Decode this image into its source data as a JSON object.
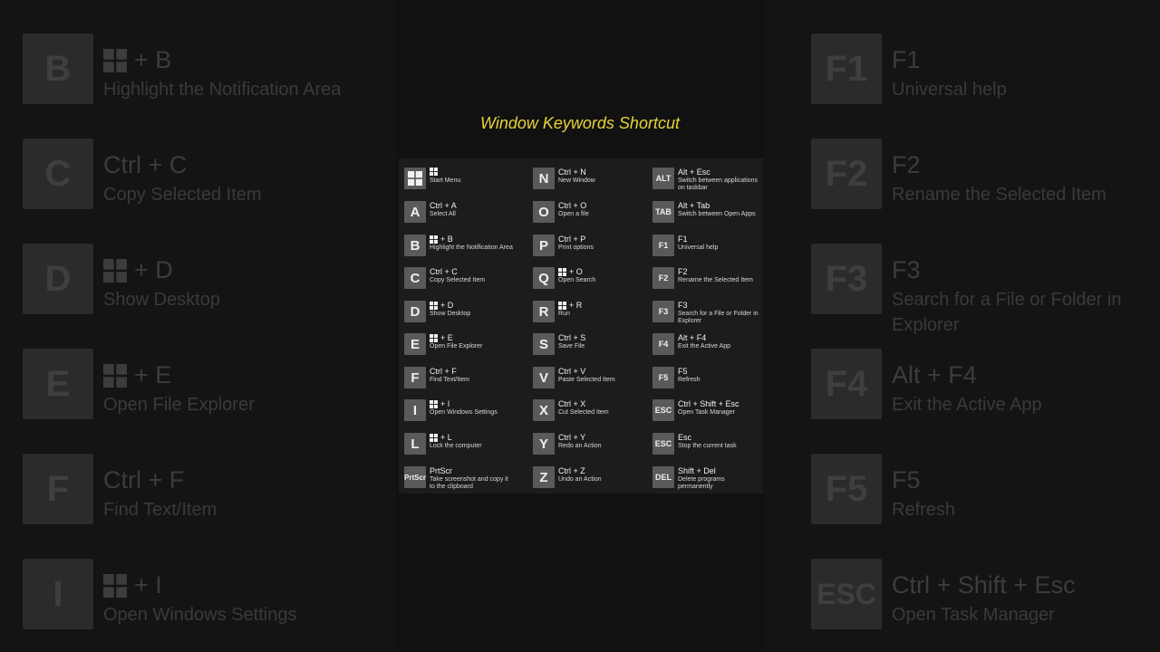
{
  "title": "Window Keywords Shortcut",
  "left_panel": [
    {
      "key": "B",
      "win": true,
      "combo": "+ B",
      "desc": "Highlight the Notification Area"
    },
    {
      "key": "C",
      "win": false,
      "combo": "Ctrl + C",
      "desc": "Copy Selected Item"
    },
    {
      "key": "D",
      "win": true,
      "combo": "+ D",
      "desc": "Show Desktop"
    },
    {
      "key": "E",
      "win": true,
      "combo": "+ E",
      "desc": "Open File Explorer"
    },
    {
      "key": "F",
      "win": false,
      "combo": "Ctrl + F",
      "desc": "Find Text/Item"
    },
    {
      "key": "I",
      "win": true,
      "combo": "+ I",
      "desc": "Open Windows Settings"
    }
  ],
  "right_panel": [
    {
      "key": "F1",
      "combo": "F1",
      "desc": "Universal help"
    },
    {
      "key": "F2",
      "combo": "F2",
      "desc": "Rename the Selected Item"
    },
    {
      "key": "F3",
      "combo": "F3",
      "desc": "Search for a File or Folder in Explorer"
    },
    {
      "key": "F4",
      "combo": "Alt  + F4",
      "desc": "Exit the Active App"
    },
    {
      "key": "F5",
      "combo": "F5",
      "desc": "Refresh"
    },
    {
      "key": "ESC",
      "combo": "Ctrl + Shift + Esc",
      "desc": "Open Task Manager"
    }
  ],
  "columns": [
    [
      {
        "key": "",
        "win_key": true,
        "win": true,
        "combo": "",
        "desc": "Start Menu"
      },
      {
        "key": "A",
        "win": false,
        "combo": "Ctrl + A",
        "desc": "Select All"
      },
      {
        "key": "B",
        "win": true,
        "combo": "+ B",
        "desc": "Highlight the Notification Area"
      },
      {
        "key": "C",
        "win": false,
        "combo": "Ctrl + C",
        "desc": "Copy Selected Item"
      },
      {
        "key": "D",
        "win": true,
        "combo": "+ D",
        "desc": "Show Desktop"
      },
      {
        "key": "E",
        "win": true,
        "combo": "+ E",
        "desc": "Open File Explorer"
      },
      {
        "key": "F",
        "win": false,
        "combo": "Ctrl + F",
        "desc": "Find Text/Item"
      },
      {
        "key": "I",
        "win": true,
        "combo": "+ I",
        "desc": "Open Windows Settings"
      },
      {
        "key": "L",
        "win": true,
        "combo": "+ L",
        "desc": "Lock the computer"
      },
      {
        "key": "PrtScr",
        "win": false,
        "combo": "PrtScr",
        "desc": "Take screenshot and copy it to the clipboard"
      }
    ],
    [
      {
        "key": "N",
        "win": false,
        "combo": "Ctrl + N",
        "desc": "New Window"
      },
      {
        "key": "O",
        "win": false,
        "combo": "Ctrl + O",
        "desc": "Open a file"
      },
      {
        "key": "P",
        "win": false,
        "combo": "Ctrl  + P",
        "desc": "Print options"
      },
      {
        "key": "Q",
        "win": true,
        "combo": "+ O",
        "desc": "Open Search"
      },
      {
        "key": "R",
        "win": true,
        "combo": "+ R",
        "desc": "Run"
      },
      {
        "key": "S",
        "win": false,
        "combo": "Ctrl + S",
        "desc": "Save File"
      },
      {
        "key": "V",
        "win": false,
        "combo": "Ctrl + V",
        "desc": "Paste Selected Item"
      },
      {
        "key": "X",
        "win": false,
        "combo": "Ctrl + X",
        "desc": "Cut Selected Item"
      },
      {
        "key": "Y",
        "win": false,
        "combo": "Ctrl + Y",
        "desc": "Redo an Action"
      },
      {
        "key": "Z",
        "win": false,
        "combo": "Ctrl + Z",
        "desc": "Undo an Action"
      }
    ],
    [
      {
        "key": "ALT",
        "win": false,
        "combo": "Alt + Esc",
        "desc": "Switch between applications on taskbar"
      },
      {
        "key": "TAB",
        "win": false,
        "combo": "Alt + Tab",
        "desc": "Switch between Open Apps"
      },
      {
        "key": "F1",
        "win": false,
        "combo": "F1",
        "desc": "Universal help"
      },
      {
        "key": "F2",
        "win": false,
        "combo": "F2",
        "desc": "Rename the Selected Item"
      },
      {
        "key": "F3",
        "win": false,
        "combo": "F3",
        "desc": "Search for a File or Folder in Explorer"
      },
      {
        "key": "F4",
        "win": false,
        "combo": "Alt  + F4",
        "desc": "Exit the Active App"
      },
      {
        "key": "F5",
        "win": false,
        "combo": "F5",
        "desc": "Refresh"
      },
      {
        "key": "ESC",
        "win": false,
        "combo": "Ctrl + Shift + Esc",
        "desc": "Open Task Manager"
      },
      {
        "key": "ESC",
        "win": false,
        "combo": "Esc",
        "desc": "Stop the current task"
      },
      {
        "key": "DEL",
        "win": false,
        "combo": "Shift + Del",
        "desc": "Delete programs permanently"
      }
    ]
  ],
  "colors": {
    "title": "#e8d23a",
    "key": "#5a5a5a",
    "card": "#1d1c1b",
    "background": "#0b0b0b"
  }
}
